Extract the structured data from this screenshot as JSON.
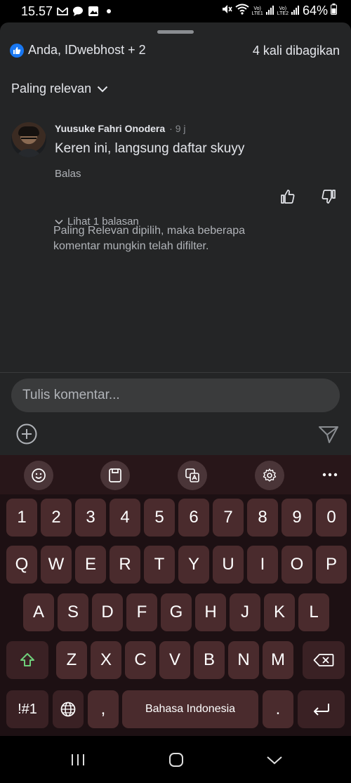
{
  "status_bar": {
    "time": "15.57",
    "left_icons": [
      "gmail-icon",
      "chat-bubble-icon",
      "gallery-icon",
      "dot-icon"
    ],
    "lte1_label": "Vo)\nLTE1",
    "lte2_label": "Vo)\nLTE2",
    "battery": "64%"
  },
  "sheet": {
    "reactions_text": "Anda, IDwebhost + 2",
    "shares_text": "4 kali dibagikan",
    "sort_label": "Paling relevan"
  },
  "comment": {
    "author": "Yuusuke Fahri Onodera",
    "time": "· 9 j",
    "text": "Keren ini, langsung daftar skuyy",
    "reply_label": "Balas",
    "view_replies": "Lihat 1 balasan"
  },
  "filter_note": "Paling Relevan dipilih, maka beberapa komentar mungkin telah difilter.",
  "composer": {
    "placeholder": "Tulis komentar..."
  },
  "keyboard": {
    "toolbar": [
      "emoji-icon",
      "clipboard-icon",
      "translate-icon",
      "settings-icon",
      "more-icon"
    ],
    "row_numbers": [
      "1",
      "2",
      "3",
      "4",
      "5",
      "6",
      "7",
      "8",
      "9",
      "0"
    ],
    "row_qwerty": [
      "Q",
      "W",
      "E",
      "R",
      "T",
      "Y",
      "U",
      "I",
      "O",
      "P"
    ],
    "row_asdf": [
      "A",
      "S",
      "D",
      "F",
      "G",
      "H",
      "J",
      "K",
      "L"
    ],
    "row_zxcv": [
      "Z",
      "X",
      "C",
      "V",
      "B",
      "N",
      "M"
    ],
    "symbols_key": "!#1",
    "comma_key": ",",
    "space_label": "Bahasa Indonesia",
    "period_key": ".",
    "shift_color": "#6fcf7a"
  },
  "navbar": [
    "recent-apps-icon",
    "home-icon",
    "back-icon"
  ]
}
